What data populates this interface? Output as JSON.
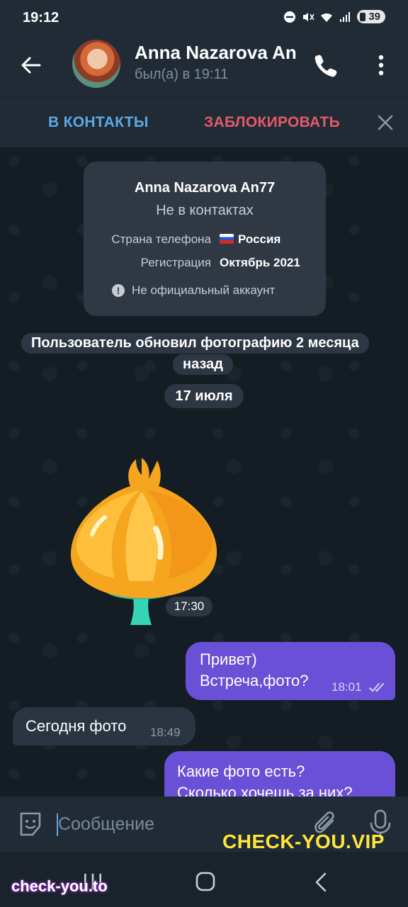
{
  "status_bar": {
    "time": "19:12",
    "battery": "39"
  },
  "header": {
    "contact_name": "Anna Nazarova An",
    "last_seen": "был(а) в 19:11"
  },
  "action_bar": {
    "add_contact_label": "В КОНТАКТЫ",
    "block_label": "ЗАБЛОКИРОВАТЬ"
  },
  "info_card": {
    "full_name": "Anna Nazarova An77",
    "status": "Не в контактах",
    "country_label": "Страна телефона",
    "country_value": "Россия",
    "registration_label": "Регистрация",
    "registration_value": "Октябрь 2021",
    "note": "Не официальный аккаунт"
  },
  "service_message": {
    "line1": "Пользователь обновил фотографию 2 месяца",
    "line2": "назад"
  },
  "date_chip": "17 июля",
  "messages": [
    {
      "type": "sticker",
      "direction": "incoming",
      "time": "17:30"
    },
    {
      "type": "text",
      "direction": "outgoing",
      "lines": [
        "Привет)",
        "Встреча,фото?"
      ],
      "time": "18:01",
      "read": true
    },
    {
      "type": "text",
      "direction": "incoming",
      "lines": [
        "Сегодня фото"
      ],
      "time": "18:49"
    },
    {
      "type": "text",
      "direction": "outgoing",
      "lines": [
        "Какие фото есть?",
        "Сколько хочешь за них?"
      ]
    }
  ],
  "input": {
    "placeholder": "Сообщение"
  },
  "watermarks": {
    "top": "CHECK-YOU.VIP",
    "bottom": "check-you.to"
  },
  "colors": {
    "accent": "#5ea8e6",
    "danger": "#e5596a",
    "outgoing_bubble": "#6a50d7",
    "watermark_yellow": "#ffe63b"
  }
}
